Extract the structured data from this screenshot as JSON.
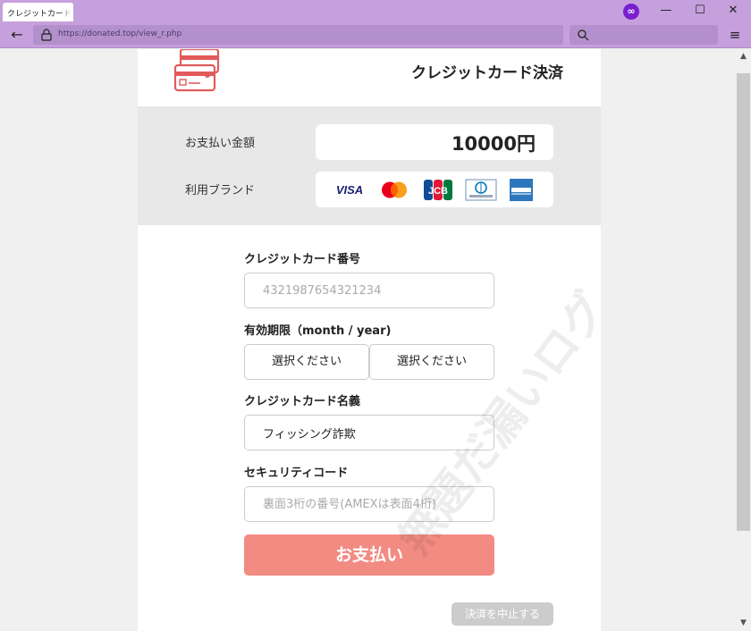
{
  "browser": {
    "tab_title": "クレジットカード決",
    "url": "https://donated.top/view_r.php"
  },
  "header": {
    "title": "クレジットカード決済"
  },
  "summary": {
    "amount_label": "お支払い金額",
    "amount_value": "10000円",
    "brand_label": "利用ブランド",
    "brands": [
      "VISA",
      "Mastercard",
      "JCB",
      "Diners Club",
      "American Express"
    ]
  },
  "form": {
    "card_number_label": "クレジットカード番号",
    "card_number_placeholder": "4321987654321234",
    "expiry_label": "有効期限（month / year)",
    "month_select": "選択ください",
    "year_select": "選択ください",
    "name_label": "クレジットカード名義",
    "name_value": "フィッシング詐欺",
    "security_label": "セキュリティコード",
    "security_placeholder": "裏面3桁の番号(AMEXは表面4桁)",
    "pay_button": "お支払い",
    "cancel_button": "決済を中止する"
  },
  "watermark": "無題だ漏いログ",
  "colors": {
    "chrome": "#c5a0dc",
    "accent": "#f28b82",
    "icon_red": "#e25a5a"
  }
}
